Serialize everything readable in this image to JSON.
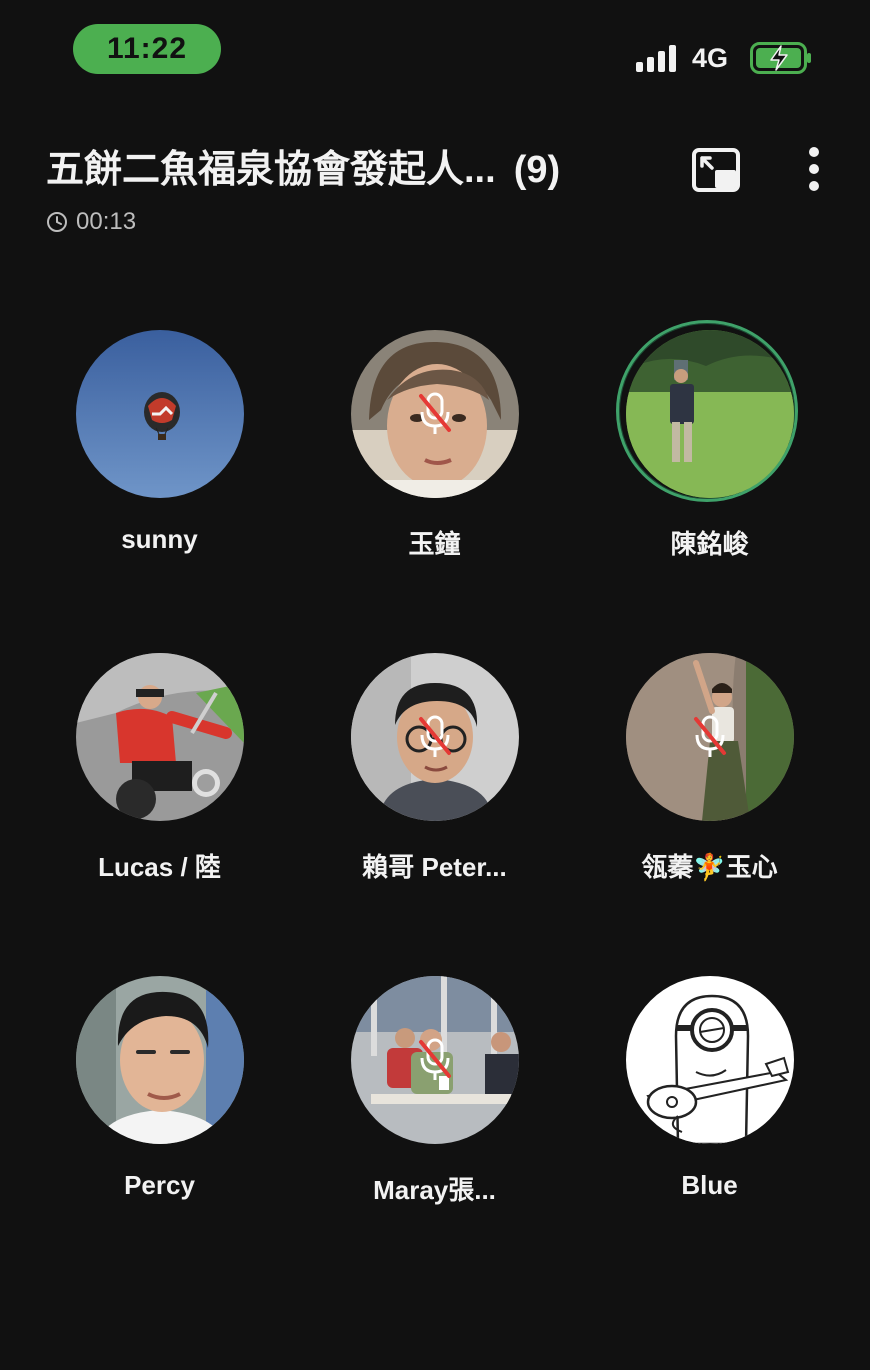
{
  "status_bar": {
    "time": "11:22",
    "network": "4G",
    "icons": [
      "signal-bars-icon",
      "battery-charging-icon"
    ],
    "accent_color": "#4caf50"
  },
  "header": {
    "title": "五餅二魚福泉協會發起人...",
    "participant_count": "(9)",
    "call_duration": "00:13",
    "icons": [
      "clock-icon",
      "picture-in-picture-icon",
      "more-vertical-icon"
    ]
  },
  "participants": [
    {
      "name": "sunny",
      "muted": false,
      "speaking": false,
      "avatar": "hot-air-balloon-sky"
    },
    {
      "name": "玉鐘",
      "muted": true,
      "speaking": false,
      "avatar": "woman-portrait"
    },
    {
      "name": "陳銘峻",
      "muted": false,
      "speaking": true,
      "avatar": "man-standing-on-grass"
    },
    {
      "name": "Lucas / 陸",
      "muted": false,
      "speaking": false,
      "avatar": "man-on-motorcycle"
    },
    {
      "name": "賴哥 Peter...",
      "muted": true,
      "speaking": false,
      "avatar": "man-with-glasses"
    },
    {
      "name": "瓴蓁🧚玉心",
      "muted": true,
      "speaking": false,
      "avatar": "woman-on-rock"
    },
    {
      "name": "Percy",
      "muted": false,
      "speaking": false,
      "avatar": "man-portrait"
    },
    {
      "name": "Maray張...",
      "muted": true,
      "speaking": false,
      "avatar": "classroom-group"
    },
    {
      "name": "Blue",
      "muted": false,
      "speaking": false,
      "avatar": "minion-cartoon-drawing"
    }
  ],
  "colors": {
    "background": "#111111",
    "speaking_ring": "#3fa26a",
    "muted_slash": "#e53935"
  }
}
